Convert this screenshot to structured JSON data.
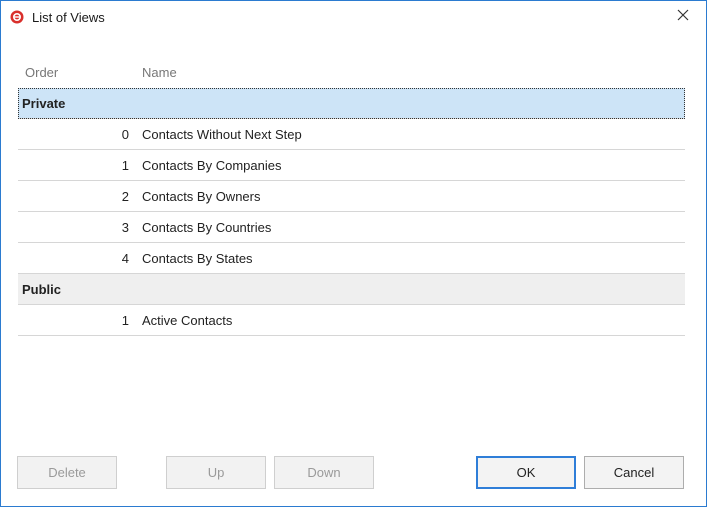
{
  "window": {
    "title": "List of Views"
  },
  "columns": {
    "order": "Order",
    "name": "Name"
  },
  "groups": [
    {
      "label": "Private",
      "rows": [
        {
          "order": "0",
          "name": "Contacts Without Next Step"
        },
        {
          "order": "1",
          "name": "Contacts By Companies"
        },
        {
          "order": "2",
          "name": "Contacts By Owners"
        },
        {
          "order": "3",
          "name": "Contacts By Countries"
        },
        {
          "order": "4",
          "name": "Contacts By States"
        }
      ]
    },
    {
      "label": "Public",
      "rows": [
        {
          "order": "1",
          "name": "Active Contacts"
        }
      ]
    }
  ],
  "buttons": {
    "delete": "Delete",
    "up": "Up",
    "down": "Down",
    "ok": "OK",
    "cancel": "Cancel"
  },
  "icons": {
    "app": "app-logo-icon",
    "close": "close-icon"
  },
  "colors": {
    "accent": "#2f7ed8",
    "selection": "#cde4f7",
    "brand": "#d9302c"
  }
}
